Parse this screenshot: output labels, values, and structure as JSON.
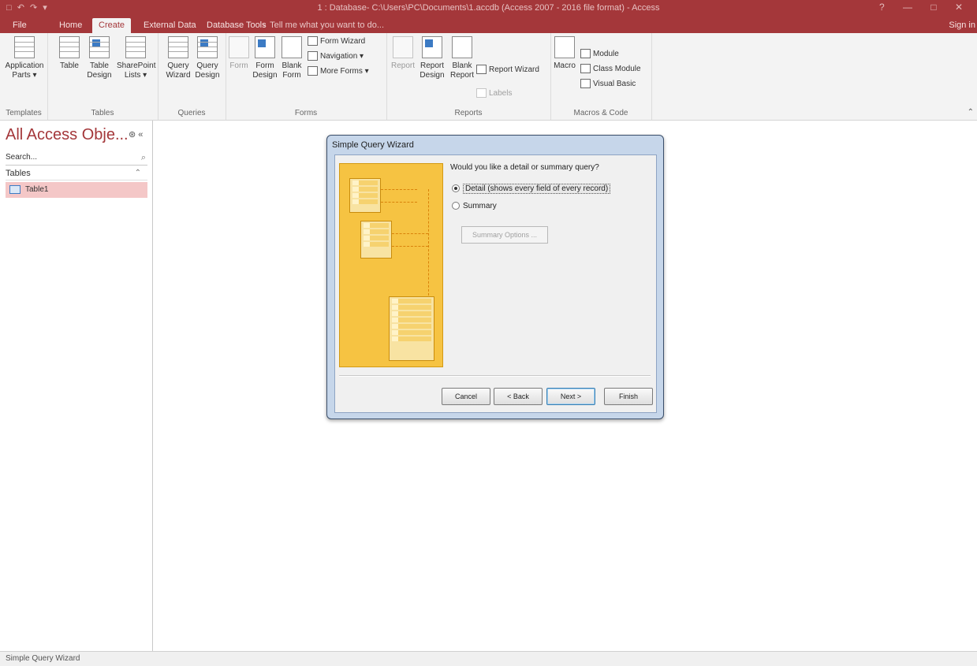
{
  "window": {
    "qat": "□ ↶ ↷ ▾",
    "title": "1 : Database- C:\\Users\\PC\\Documents\\1.accdb (Access 2007 - 2016 file format) - Access",
    "controls": "? — □ ✕"
  },
  "tabs": [
    {
      "label": "File"
    },
    {
      "label": "Home"
    },
    {
      "label": "Create"
    },
    {
      "label": "External Data"
    },
    {
      "label": "Database Tools"
    }
  ],
  "tell_me": "♀ Tell me what you want to do...",
  "sign_in": "Sign in",
  "ribbon": {
    "templates": {
      "label": "Templates",
      "application_parts": "Application Parts ▾"
    },
    "tables": {
      "label": "Tables",
      "table": "Table",
      "table_design": "Table Design",
      "sharepoint_lists": "SharePoint Lists ▾"
    },
    "queries": {
      "label": "Queries",
      "query_wizard": "Query Wizard",
      "query_design": "Query Design"
    },
    "forms": {
      "label": "Forms",
      "form": "Form",
      "form_design": "Form Design",
      "blank_form": "Blank Form",
      "form_wizard": "Form Wizard",
      "navigation": "Navigation ▾",
      "more_forms": "More Forms ▾"
    },
    "reports": {
      "label": "Reports",
      "report": "Report",
      "report_design": "Report Design",
      "blank_report": "Blank Report",
      "report_wizard": "Report Wizard",
      "labels": "Labels"
    },
    "macros": {
      "label": "Macros & Code",
      "macro": "Macro",
      "module": "Module",
      "class_module": "Class Module",
      "visual_basic": "Visual Basic"
    },
    "collapse": "⌃"
  },
  "nav": {
    "title": "All Access Obje...",
    "controls": "⊛ «",
    "search_placeholder": "Search...",
    "search_icon": "magnifier-icon",
    "section": "Tables",
    "section_chevron": "⌃",
    "items": [
      {
        "label": "Table1"
      }
    ]
  },
  "dialog": {
    "title": "Simple Query Wizard",
    "question": "Would you like a detail or summary query?",
    "options": [
      {
        "label": "Detail (shows every field of every record)",
        "selected": true
      },
      {
        "label": "Summary",
        "selected": false
      }
    ],
    "summary_options": "Summary Options ...",
    "buttons": {
      "cancel": "Cancel",
      "back": "< Back",
      "next": "Next >",
      "finish": "Finish"
    }
  },
  "status": "Simple Query Wizard",
  "colors": {
    "accent": "#a4373a",
    "illustration": "#f6c342",
    "selection": "#f4c7c7"
  }
}
